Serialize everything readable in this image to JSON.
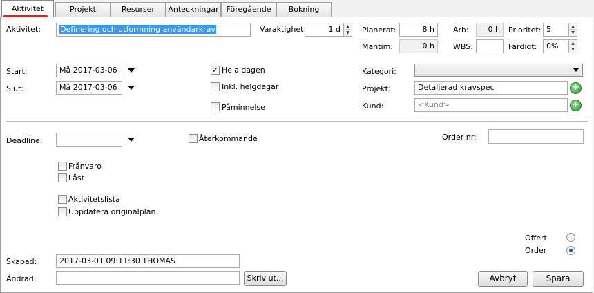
{
  "tabs": [
    {
      "label": "Aktivitet"
    },
    {
      "label": "Projekt"
    },
    {
      "label": "Resurser"
    },
    {
      "label": "Anteckningar"
    },
    {
      "label": "Föregående"
    },
    {
      "label": "Bokning"
    }
  ],
  "form": {
    "aktivitet_label": "Aktivitet:",
    "aktivitet_value": "Definering och utformning användarkrav",
    "varaktighet_label": "Varaktighet:",
    "varaktighet_value": "1 d",
    "planerat_label": "Planerat:",
    "planerat_value": "8 h",
    "arb_label": "Arb:",
    "arb_value": "0 h",
    "prioritet_label": "Prioritet:",
    "prioritet_value": "5",
    "mantim_label": "Mantim:",
    "mantim_value": "0 h",
    "wbs_label": "WBS:",
    "wbs_value": "",
    "fardigt_label": "Färdigt:",
    "fardigt_value": "0%",
    "start_label": "Start:",
    "start_value": "Må 2017-03-06",
    "slut_label": "Slut:",
    "slut_value": "Må 2017-03-06",
    "hela_dagen_label": "Hela dagen",
    "hela_dagen_checked": true,
    "inkl_helgdagar_label": "Inkl. helgdagar",
    "paminnelse_label": "Påminnelse",
    "kategori_label": "Kategori:",
    "kategori_value": "",
    "projekt_label": "Projekt:",
    "projekt_value": "Detaljerad kravspec",
    "kund_label": "Kund:",
    "kund_placeholder": "<Kund>",
    "deadline_label": "Deadline:",
    "deadline_value": "",
    "aterkommande_label": "Återkommande",
    "order_nr_label": "Order nr:",
    "order_nr_value": "",
    "franvaro_label": "Frånvaro",
    "last_label": "Låst",
    "aktivitetslista_label": "Aktivitetslista",
    "uppdatera_label": "Uppdatera originalplan",
    "offert_label": "Offert",
    "order_label": "Order",
    "selected_radio": "Order",
    "skapad_label": "Skapad:",
    "skapad_value": "2017-03-01 09:11:30 THOMAS",
    "andrad_label": "Ändrad:",
    "andrad_value": ""
  },
  "buttons": {
    "skriv_ut": "Skriv ut...",
    "avbryt": "Avbryt",
    "spara": "Spara"
  },
  "colors": {
    "selection": "#3399ff",
    "tab_accent": "#e0201c",
    "add_button": "#2e9e2e"
  }
}
